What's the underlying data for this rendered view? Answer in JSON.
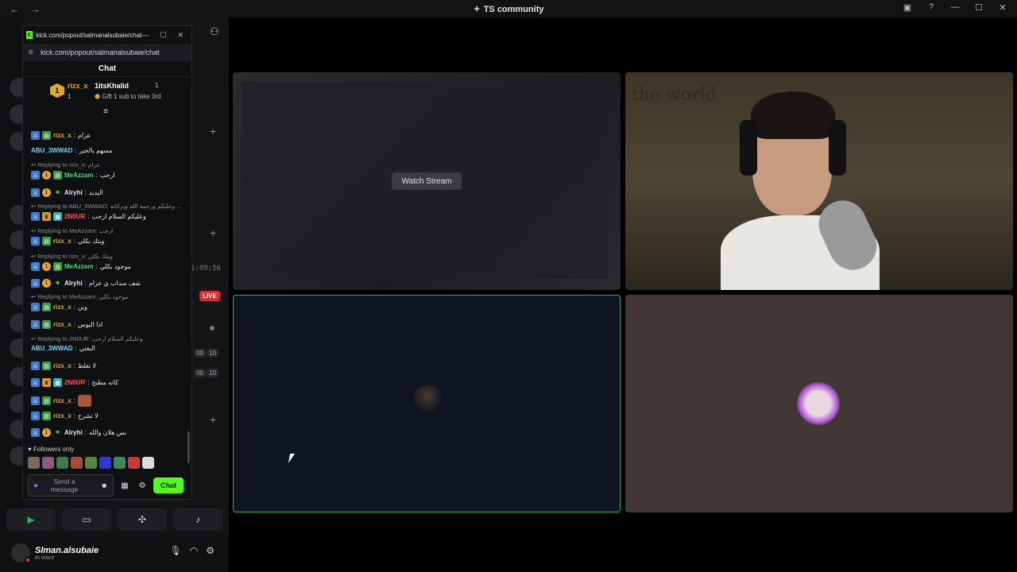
{
  "window": {
    "title": "TS community",
    "back": "←",
    "forward": "→",
    "controls": [
      "▣",
      "?",
      "—",
      "☐",
      "✕"
    ]
  },
  "popout": {
    "title": "kick.com/popout/salmanalsubaie/chat",
    "url": "kick.com/popout/salmanalsubaie/chat",
    "header": "Chat",
    "leaderboard": {
      "first_rank": "1",
      "first_name": "rizx_x",
      "first_count": "1",
      "second_name": "1itsKhalid",
      "second_count": "1",
      "gift_text": "Gift 1 sub to take 3rd"
    },
    "messages": [
      {
        "user": "rizx_x",
        "text": "عزام",
        "color": "#e4a72a"
      },
      {
        "user": "ABU_3WWAD",
        "text": "مسهم بالخير",
        "color": "#6ad7f5"
      },
      {
        "reply": "Replying to rizx_x: عزام"
      },
      {
        "user": "MeAzzam",
        "text": "ارحب",
        "color": "#3fd97a"
      },
      {
        "user": "Alryhi",
        "text": "البديد",
        "color": "#e8e8e8"
      },
      {
        "reply": "Replying to ABU_3WWAD: وعليكم ورحمة الله وبركاته ..."
      },
      {
        "user": "2N0UR",
        "text": "وعليكم السلام ارحب",
        "color": "#f05a5a"
      },
      {
        "reply": "Replying to MeAzzam: ارحب"
      },
      {
        "user": "rizx_x",
        "text": "ويتك بكلي",
        "color": "#e4a72a"
      },
      {
        "reply": "Replying to rizx_x: ويتك بكلي"
      },
      {
        "user": "MeAzzam",
        "text": "موجود بكلي",
        "color": "#3fd97a"
      },
      {
        "user": "Alryhi",
        "text": "شف سداب ي عزام",
        "color": "#e8e8e8"
      },
      {
        "reply": "Replying to MeAzzam: موجود بكلي"
      },
      {
        "user": "rizx_x",
        "text": "وين",
        "color": "#e4a72a"
      },
      {
        "user": "rizx_x",
        "text": "اذا اليوس",
        "color": "#e4a72a"
      },
      {
        "reply": "Replying to 2N0UR: وعليكم السلام ارحب"
      },
      {
        "user": "ABU_3WWAD",
        "text": "البغني",
        "color": "#6ad7f5"
      },
      {
        "user": "rizx_x",
        "text": "لا تغلط",
        "color": "#e4a72a"
      },
      {
        "user": "2N0UR",
        "text": "كانه مطبخ",
        "color": "#f05a5a"
      },
      {
        "user": "rizx_x",
        "text": "",
        "color": "#e4a72a"
      },
      {
        "user": "rizx_x",
        "text": "لا تشرح",
        "color": "#e4a72a"
      },
      {
        "user": "Alryhi",
        "text": "بس هلان والله",
        "color": "#e8e8e8"
      }
    ],
    "followers_only": "Followers only",
    "input_placeholder": "Send a message",
    "chat_button": "Chat"
  },
  "discord": {
    "time": "1:09:56",
    "live": "LIVE",
    "counters": [
      "00",
      "10",
      "00",
      "10"
    ],
    "user": {
      "name": "Slman.alsubaie",
      "status": "In voice"
    }
  },
  "stage": {
    "watch_stream": "Watch Stream",
    "wall_text": "the world"
  }
}
